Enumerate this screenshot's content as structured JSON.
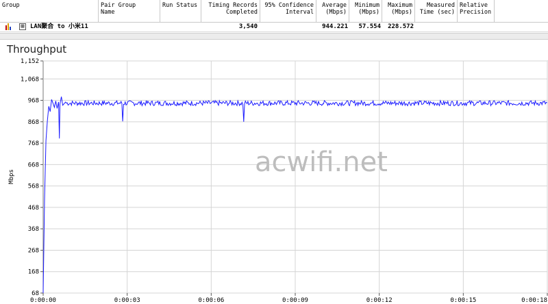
{
  "table": {
    "columns": [
      {
        "label": "Group",
        "left": 0,
        "width": 144
      },
      {
        "label": "Pair Group\nName",
        "left": 144,
        "width": 90
      },
      {
        "label": "Run Status",
        "left": 234,
        "width": 60
      },
      {
        "label": "Timing Records\nCompleted",
        "left": 294,
        "width": 86,
        "right": true
      },
      {
        "label": "95% Confidence\nInterval",
        "left": 380,
        "width": 82,
        "right": true
      },
      {
        "label": "Average\n(Mbps)",
        "left": 462,
        "width": 48,
        "right": true
      },
      {
        "label": "Minimum\n(Mbps)",
        "left": 510,
        "width": 48,
        "right": true
      },
      {
        "label": "Maximum\n(Mbps)",
        "left": 558,
        "width": 48,
        "right": true
      },
      {
        "label": "Measured\nTime (sec)",
        "left": 606,
        "width": 62,
        "right": true
      },
      {
        "label": "Relative\nPrecision",
        "left": 668,
        "width": 54
      }
    ],
    "row": {
      "expand": "⊞",
      "group": "LAN聚合 to 小米11",
      "records": "3,540",
      "average": "944.221",
      "minimum": "57.554",
      "maximum": "228.572"
    }
  },
  "watermark": "acwifi.net",
  "chart_data": {
    "type": "line",
    "title": "Throughput",
    "ylabel": "Mbps",
    "ylim": [
      68,
      1152
    ],
    "yticks": [
      1152,
      1068,
      968,
      868,
      768,
      668,
      568,
      468,
      368,
      268,
      168,
      68
    ],
    "xticks": [
      "0:00:00",
      "0:00:03",
      "0:00:06",
      "0:00:09",
      "0:00:12",
      "0:00:15",
      "0:00:18"
    ],
    "xlim": [
      0,
      18
    ],
    "grid": true,
    "series": [
      {
        "color": "#1a1aff",
        "points": [
          [
            0.0,
            68
          ],
          [
            0.05,
            500
          ],
          [
            0.1,
            780
          ],
          [
            0.15,
            870
          ],
          [
            0.2,
            940
          ],
          [
            0.25,
            915
          ],
          [
            0.3,
            972
          ],
          [
            0.35,
            955
          ],
          [
            0.4,
            935
          ],
          [
            0.45,
            965
          ],
          [
            0.5,
            930
          ],
          [
            0.55,
            960
          ],
          [
            0.58,
            790
          ],
          [
            0.6,
            950
          ],
          [
            0.65,
            985
          ],
          [
            0.7,
            945
          ],
          [
            0.8,
            960
          ]
        ],
        "baseline": 955,
        "noise": 12,
        "dips": [
          [
            2.85,
            870
          ],
          [
            7.15,
            868
          ]
        ],
        "x_end": 18.0
      }
    ]
  }
}
